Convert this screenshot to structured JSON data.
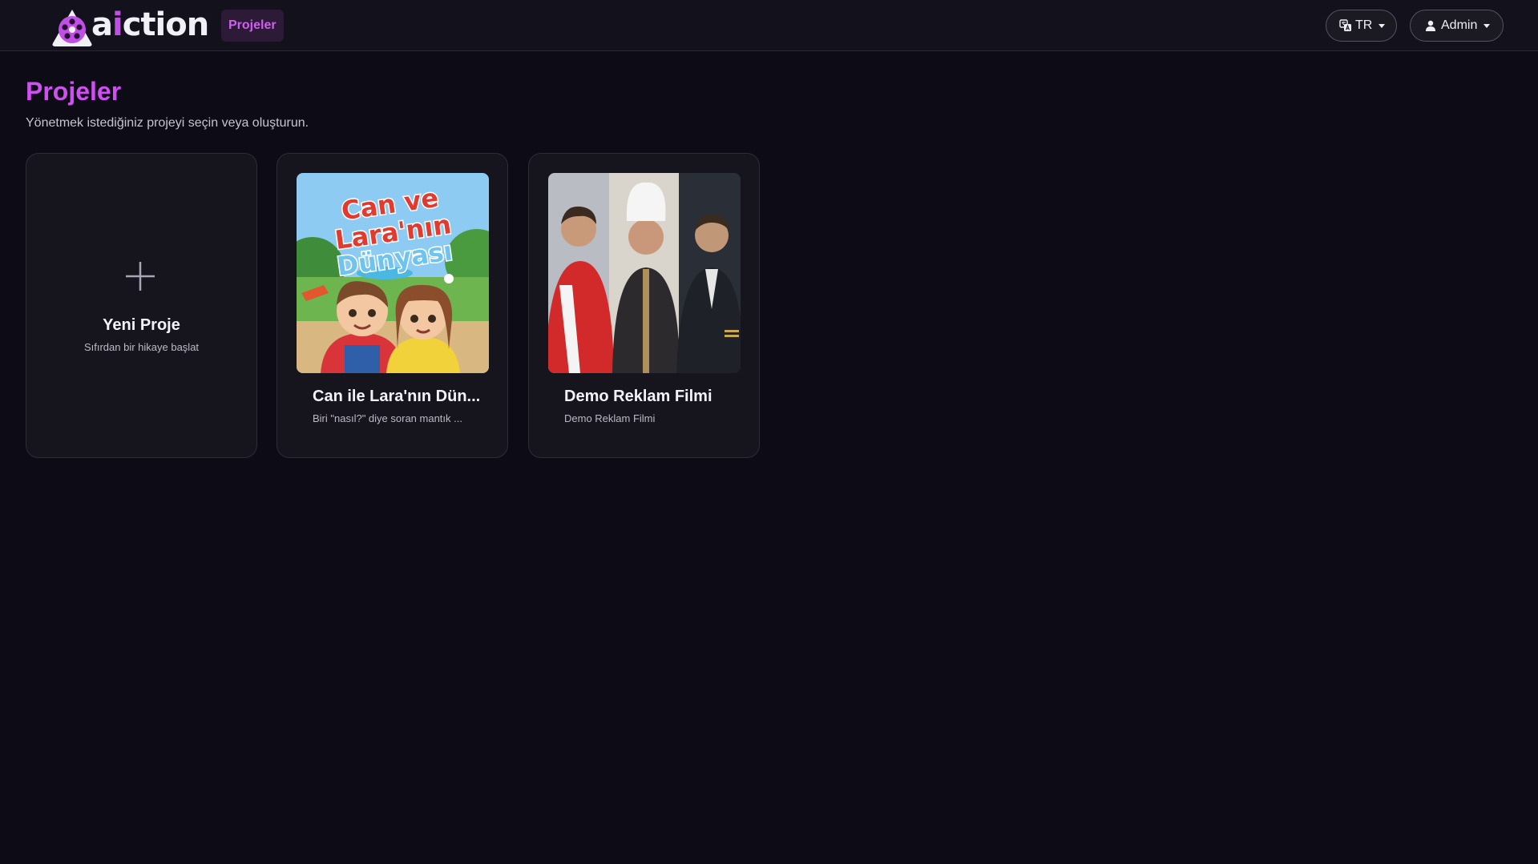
{
  "brand": {
    "name_prefix": "a",
    "name_accent": "i",
    "name_suffix": "ction",
    "accent_color": "#c04fe3"
  },
  "nav": {
    "projects_label": "Projeler"
  },
  "header": {
    "language": {
      "label": "TR",
      "icon": "translate-icon"
    },
    "user": {
      "label": "Admin",
      "icon": "user-icon"
    }
  },
  "page": {
    "title": "Projeler",
    "subtitle": "Yönetmek istediğiniz projeyi seçin veya oluşturun."
  },
  "new_project": {
    "title": "Yeni Proje",
    "subtitle": "Sıfırdan bir hikaye başlat",
    "icon": "plus-icon"
  },
  "projects": [
    {
      "title": "Can ile Lara'nın Dün...",
      "description": "Biri \"nasıl?\" diye soran mantık ...",
      "cover_text": [
        "Can ve",
        "Lara'nın",
        "Dünyası"
      ]
    },
    {
      "title": "Demo Reklam Filmi",
      "description": "Demo Reklam Filmi"
    }
  ]
}
